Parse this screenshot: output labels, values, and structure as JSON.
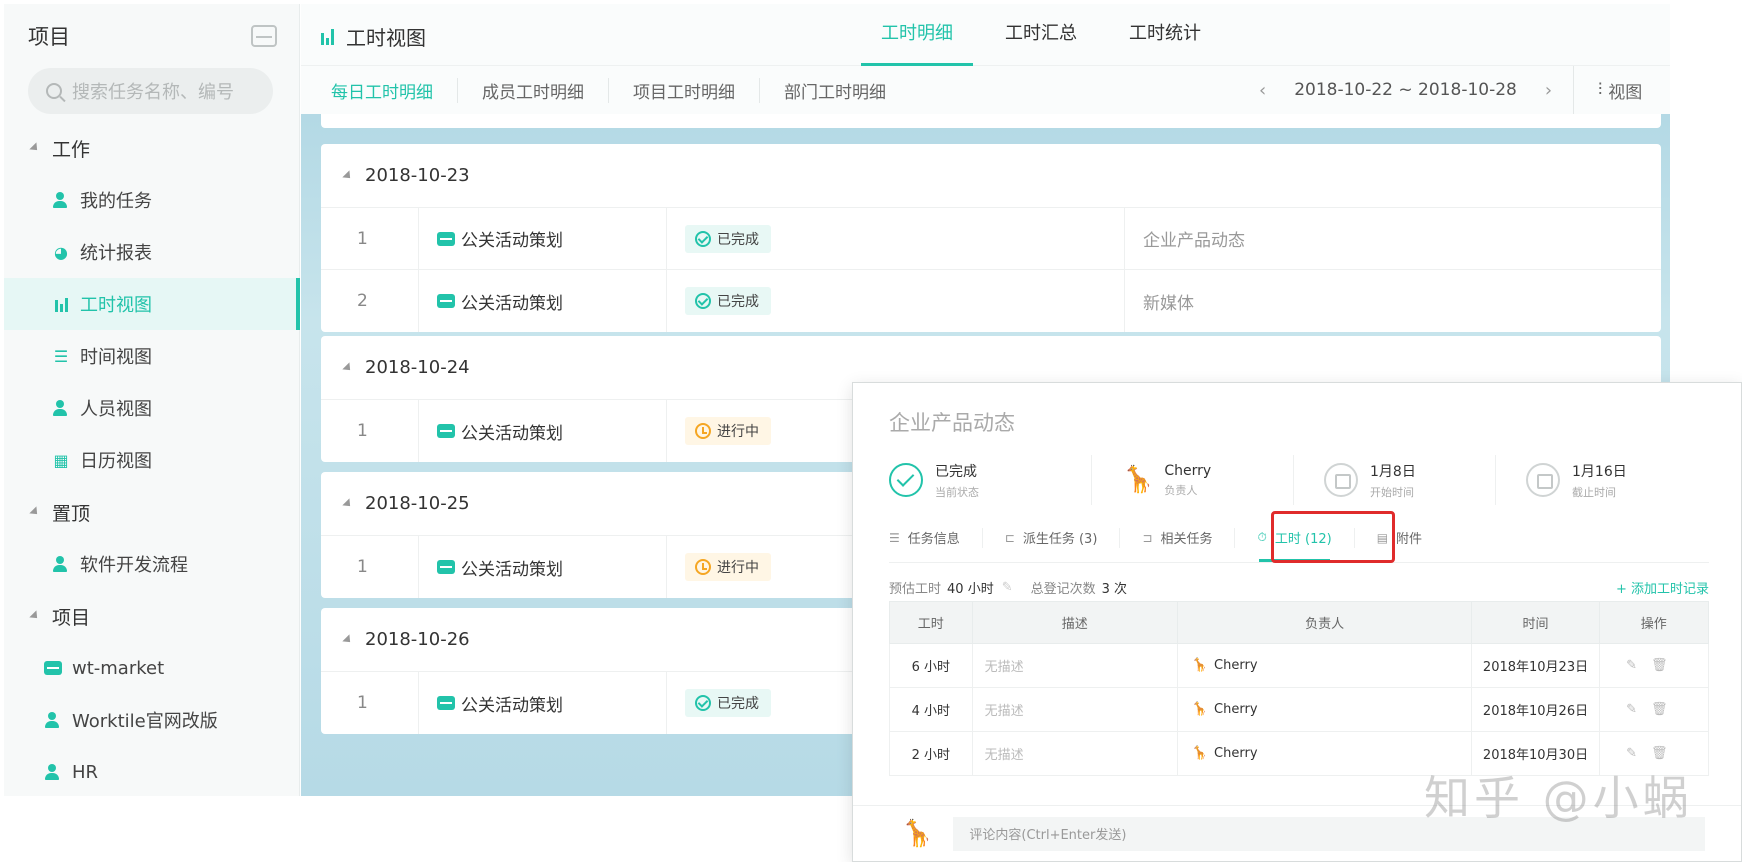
{
  "sidebar": {
    "title": "项目",
    "search_placeholder": "搜索任务名称、编号",
    "groups": [
      {
        "label": "工作",
        "items": [
          {
            "label": "我的任务",
            "icon": "person-icon"
          },
          {
            "label": "统计报表",
            "icon": "pie-chart-icon"
          },
          {
            "label": "工时视图",
            "icon": "bar-chart-icon",
            "active": true
          },
          {
            "label": "时间视图",
            "icon": "gantt-icon"
          },
          {
            "label": "人员视图",
            "icon": "people-icon"
          },
          {
            "label": "日历视图",
            "icon": "calendar-icon"
          }
        ]
      },
      {
        "label": "置顶",
        "items": [
          {
            "label": "软件开发流程",
            "icon": "person-icon"
          }
        ]
      },
      {
        "label": "项目",
        "items": [
          {
            "label": "wt-market",
            "icon": "box-icon"
          },
          {
            "label": "Worktile官网改版",
            "icon": "person-icon"
          },
          {
            "label": "HR",
            "icon": "person-icon"
          }
        ]
      }
    ]
  },
  "header": {
    "title": "工时视图",
    "tabs": [
      "工时明细",
      "工时汇总",
      "工时统计"
    ],
    "active_tab": "工时明细",
    "subtabs": [
      "每日工时明细",
      "成员工时明细",
      "项目工时明细",
      "部门工时明细"
    ],
    "active_subtab": "每日工时明细",
    "date_range": "2018-10-22 ~ 2018-10-28",
    "view_label": "视图"
  },
  "days": [
    {
      "date": "2018-10-23",
      "rows": [
        {
          "num": "1",
          "task": "公关活动策划",
          "status": "已完成",
          "status_type": "done",
          "extra": "企业产品动态"
        },
        {
          "num": "2",
          "task": "公关活动策划",
          "status": "已完成",
          "status_type": "done",
          "extra": "新媒体"
        }
      ]
    },
    {
      "date": "2018-10-24",
      "rows": [
        {
          "num": "1",
          "task": "公关活动策划",
          "status": "进行中",
          "status_type": "progress",
          "extra": ""
        }
      ]
    },
    {
      "date": "2018-10-25",
      "rows": [
        {
          "num": "1",
          "task": "公关活动策划",
          "status": "进行中",
          "status_type": "progress",
          "extra": ""
        }
      ]
    },
    {
      "date": "2018-10-26",
      "rows": [
        {
          "num": "1",
          "task": "公关活动策划",
          "status": "已完成",
          "status_type": "done",
          "extra": ""
        }
      ]
    }
  ],
  "panel": {
    "title": "企业产品动态",
    "meta": [
      {
        "value": "已完成",
        "label": "当前状态"
      },
      {
        "value": "Cherry",
        "label": "负责人"
      },
      {
        "value": "1月8日",
        "label": "开始时间"
      },
      {
        "value": "1月16日",
        "label": "截止时间"
      }
    ],
    "tabs": [
      "任务信息",
      "派生任务 (3)",
      "相关任务",
      "工时 (12)",
      "附件"
    ],
    "active_tab": "工时 (12)",
    "estimate_label": "预估工时",
    "estimate_value": "40 小时",
    "count_label": "总登记次数",
    "count_value": "3 次",
    "add_label": "+ 添加工时记录",
    "table_headers": [
      "工时",
      "描述",
      "负责人",
      "时间",
      "操作"
    ],
    "table_rows": [
      {
        "hours": "6 小时",
        "desc": "无描述",
        "owner": "Cherry",
        "date": "2018年10月23日"
      },
      {
        "hours": "4 小时",
        "desc": "无描述",
        "owner": "Cherry",
        "date": "2018年10月26日"
      },
      {
        "hours": "2 小时",
        "desc": "无描述",
        "owner": "Cherry",
        "date": "2018年10月30日"
      }
    ],
    "comment_placeholder": "评论内容(Ctrl+Enter发送)"
  },
  "watermark": "知乎 @小蜗",
  "colors": {
    "accent": "#22c3aa",
    "highlight": "#e02b2b",
    "progress": "#f5a623"
  }
}
